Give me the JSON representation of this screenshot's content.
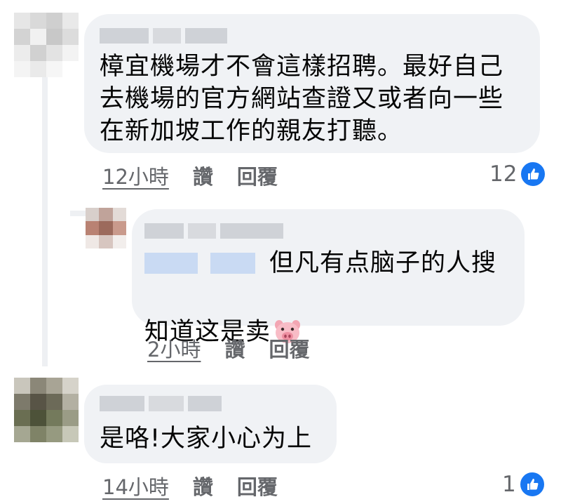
{
  "comments": [
    {
      "text": "樟宜機場才不會這樣招聘。最好自己\n去機場的官方網站查證又或者向一些\n在新加坡工作的親友打聽。",
      "time": "12小時",
      "like_label": "讚",
      "reply_label": "回覆",
      "reaction_count": "12",
      "reaction_icon": "thumbs-up-icon"
    },
    {
      "text_line1": "但凡有点脑子的人搜",
      "text_line2": "知道这是卖",
      "emoji": "pig-face-icon",
      "time": "2小時",
      "like_label": "讚",
      "reply_label": "回覆"
    },
    {
      "text": "是咯!大家小心为上",
      "time": "14小時",
      "like_label": "讚",
      "reply_label": "回覆",
      "reaction_count": "1",
      "reaction_icon": "thumbs-up-icon"
    }
  ],
  "colors": {
    "bubble": "#f0f2f5",
    "meta_text": "#65676b",
    "like_blue": "#1877f2",
    "mention_blur": "#c9daf3"
  }
}
